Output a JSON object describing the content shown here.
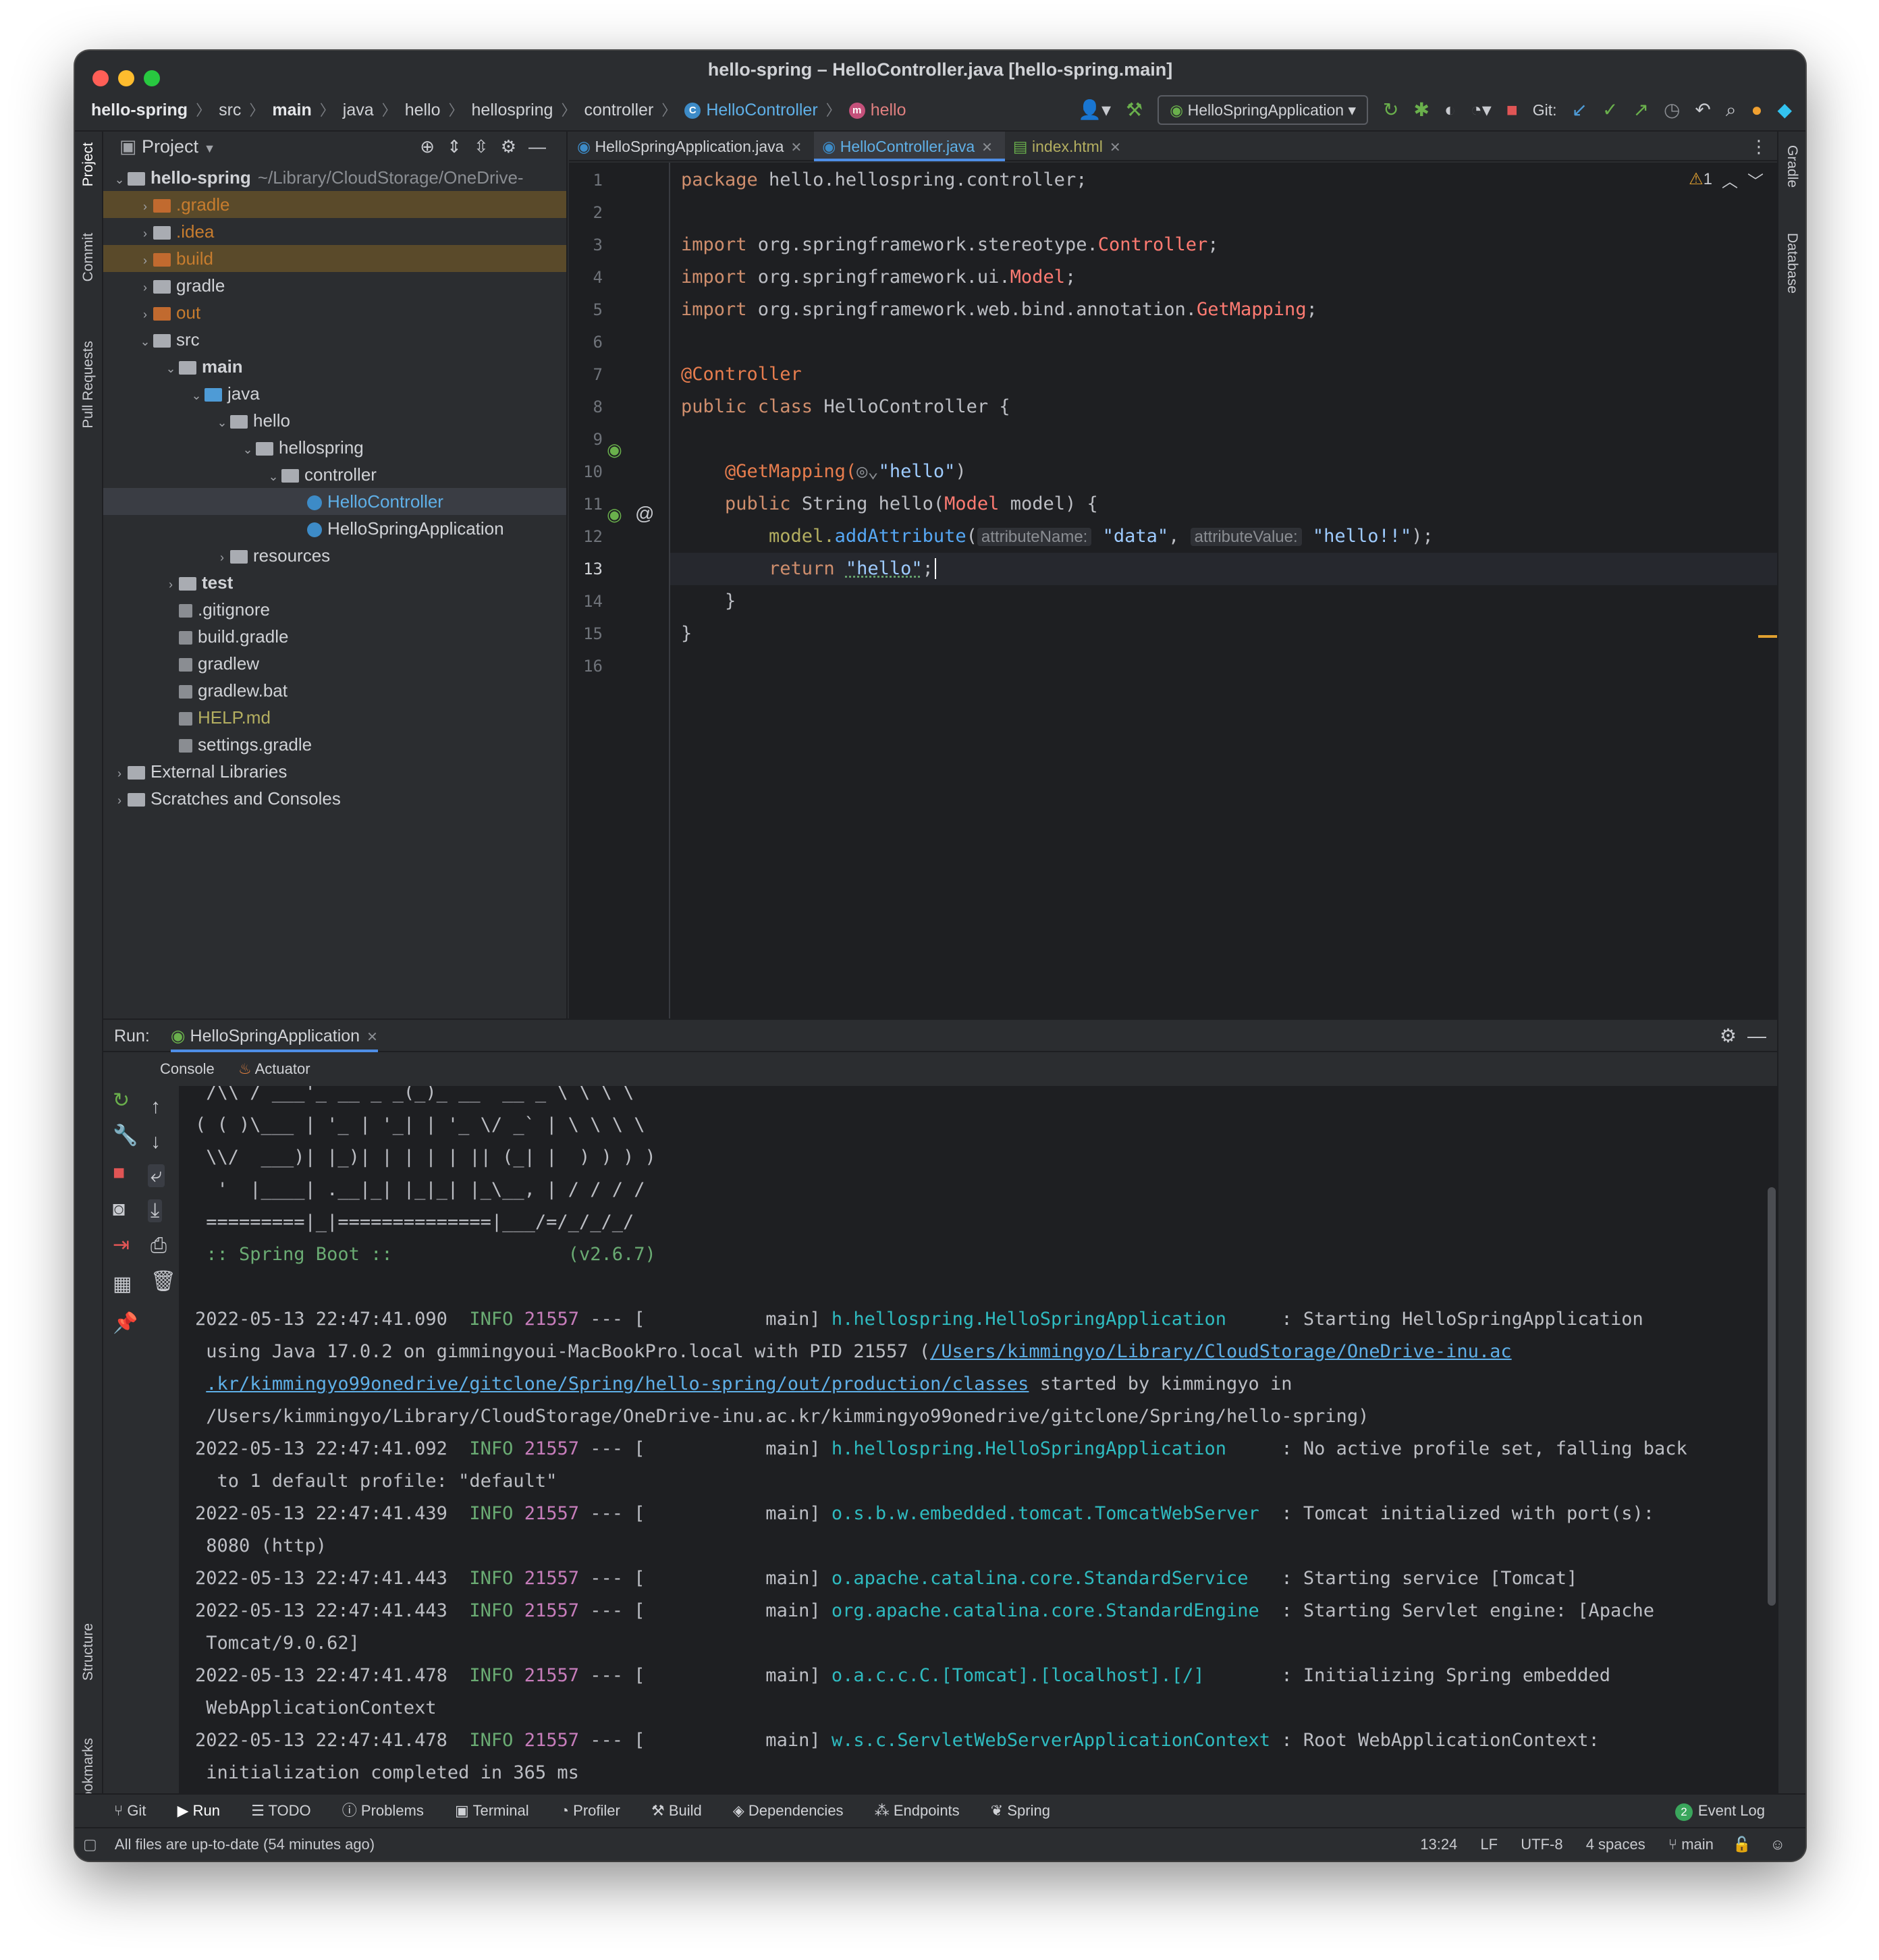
{
  "window": {
    "title": "hello-spring – HelloController.java [hello-spring.main]"
  },
  "breadcrumbs": [
    "hello-spring",
    "src",
    "main",
    "java",
    "hello",
    "hellospring",
    "controller",
    "HelloController",
    "hello"
  ],
  "toolbar": {
    "run_config": "HelloSpringApplication",
    "git_label": "Git:"
  },
  "left_strip": {
    "project": "Project",
    "commit": "Commit",
    "pull_requests": "Pull Requests",
    "structure": "Structure",
    "bookmarks": "Bookmarks"
  },
  "right_strip": {
    "gradle": "Gradle",
    "database": "Database"
  },
  "project_panel": {
    "title": "Project",
    "tree": [
      {
        "label": "hello-spring",
        "extra": "~/Library/CloudStorage/OneDrive-",
        "indent": 0,
        "bold": true
      },
      {
        "label": ".gradle",
        "indent": 1,
        "color": "#c77c2e"
      },
      {
        "label": ".idea",
        "indent": 1,
        "color": "#c77c2e"
      },
      {
        "label": "build",
        "indent": 1,
        "color": "#c77c2e"
      },
      {
        "label": "gradle",
        "indent": 1
      },
      {
        "label": "out",
        "indent": 1,
        "color": "#c77c2e"
      },
      {
        "label": "src",
        "indent": 1
      },
      {
        "label": "main",
        "indent": 2,
        "bold": true
      },
      {
        "label": "java",
        "indent": 3
      },
      {
        "label": "hello",
        "indent": 4
      },
      {
        "label": "hellospring",
        "indent": 5
      },
      {
        "label": "controller",
        "indent": 6
      },
      {
        "label": "HelloController",
        "indent": 7,
        "color": "#5fb0e8"
      },
      {
        "label": "HelloSpringApplication",
        "indent": 7
      },
      {
        "label": "resources",
        "indent": 4
      },
      {
        "label": "test",
        "indent": 2,
        "bold": true
      },
      {
        "label": ".gitignore",
        "indent": 2
      },
      {
        "label": "build.gradle",
        "indent": 2
      },
      {
        "label": "gradlew",
        "indent": 2
      },
      {
        "label": "gradlew.bat",
        "indent": 2
      },
      {
        "label": "HELP.md",
        "indent": 2,
        "color": "#b3ae60"
      },
      {
        "label": "settings.gradle",
        "indent": 2
      },
      {
        "label": "External Libraries",
        "indent": 0
      },
      {
        "label": "Scratches and Consoles",
        "indent": 0
      }
    ]
  },
  "editor_tabs": [
    "HelloSpringApplication.java",
    "HelloController.java",
    "index.html"
  ],
  "editor": {
    "warning": "1",
    "line_numbers": [
      "1",
      "2",
      "3",
      "4",
      "5",
      "6",
      "7",
      "8",
      "9",
      "10",
      "11",
      "12",
      "13",
      "14",
      "15",
      "16"
    ],
    "lines": {
      "l1a": "package ",
      "l1b": "hello.hellospring.controller;",
      "l3a": "import ",
      "l3b": "org.springframework.stereotype.",
      "l3c": "Controller",
      "l3d": ";",
      "l4a": "import ",
      "l4b": "org.springframework.ui.",
      "l4c": "Model",
      "l4d": ";",
      "l5a": "import ",
      "l5b": "org.springframework.web.bind.annotation.",
      "l5c": "GetMapping",
      "l5d": ";",
      "l7": "@Controller",
      "l8a": "public class ",
      "l8b": "HelloController {",
      "l10a": "    @GetMapping(",
      "l10b": "\"hello\"",
      "l10c": ")",
      "l11a": "    public ",
      "l11b": "String ",
      "l11c": "hello",
      "l11d": "(",
      "l11e": "Model",
      "l11f": " model) {",
      "l12a": "        model.",
      "l12b": "addAttribute",
      "l12c": "(",
      "l12h1": "attributeName:",
      "l12d": "\"data\"",
      "l12e": ", ",
      "l12h2": "attributeValue:",
      "l12f": "\"hello!!\"",
      "l12g": ");",
      "l13a": "        return ",
      "l13b": "\"hello\"",
      "l13c": ";",
      "l14": "    }",
      "l15": "}"
    }
  },
  "run": {
    "label": "Run:",
    "config": "HelloSpringApplication",
    "subtabs": [
      "Console",
      "Actuator"
    ]
  },
  "console": {
    "banner": [
      " /\\\\ / ___'_ __ _ _(_)_ __  __ _ \\ \\ \\ \\",
      "( ( )\\___ | '_ | '_| | '_ \\/ _` | \\ \\ \\ \\",
      " \\\\/  ___)| |_)| | | | | || (_| |  ) ) ) )",
      "  '  |____| .__|_| |_|_| |_\\__, | / / / /",
      " =========|_|==============|___/=/_/_/_/",
      " :: Spring Boot ::                (v2.6.7)"
    ],
    "log": [
      {
        "ts": "2022-05-13 22:47:41.090",
        "lvl": "INFO",
        "pid": "21557",
        "sep": " --- [           main] ",
        "cls": "h.hellospring.HelloSpringApplication    ",
        "msg": " : Starting HelloSpringApplication"
      },
      {
        "cont": " using Java 17.0.2 on gimmingyoui-MacBookPro.local with PID 21557 (",
        "link": "/Users/kimmingyo/Library/CloudStorage/OneDrive-inu.ac"
      },
      {
        "cont": " ",
        "link": ".kr/kimmingyo99onedrive/gitclone/Spring/hello-spring/out/production/classes",
        "after": " started by kimmingyo in"
      },
      {
        "cont": " /Users/kimmingyo/Library/CloudStorage/OneDrive-inu.ac.kr/kimmingyo99onedrive/gitclone/Spring/hello-spring)"
      },
      {
        "ts": "2022-05-13 22:47:41.092",
        "lvl": "INFO",
        "pid": "21557",
        "sep": " --- [           main] ",
        "cls": "h.hellospring.HelloSpringApplication    ",
        "msg": " : No active profile set, falling back"
      },
      {
        "cont": "  to 1 default profile: \"default\""
      },
      {
        "ts": "2022-05-13 22:47:41.439",
        "lvl": "INFO",
        "pid": "21557",
        "sep": " --- [           main] ",
        "cls": "o.s.b.w.embedded.tomcat.TomcatWebServer ",
        "msg": " : Tomcat initialized with port(s):"
      },
      {
        "cont": " 8080 (http)"
      },
      {
        "ts": "2022-05-13 22:47:41.443",
        "lvl": "INFO",
        "pid": "21557",
        "sep": " --- [           main] ",
        "cls": "o.apache.catalina.core.StandardService  ",
        "msg": " : Starting service [Tomcat]"
      },
      {
        "ts": "2022-05-13 22:47:41.443",
        "lvl": "INFO",
        "pid": "21557",
        "sep": " --- [           main] ",
        "cls": "org.apache.catalina.core.StandardEngine ",
        "msg": " : Starting Servlet engine: [Apache"
      },
      {
        "cont": " Tomcat/9.0.62]"
      },
      {
        "ts": "2022-05-13 22:47:41.478",
        "lvl": "INFO",
        "pid": "21557",
        "sep": " --- [           main] ",
        "cls": "o.a.c.c.C.[Tomcat].[localhost].[/]      ",
        "msg": " : Initializing Spring embedded"
      },
      {
        "cont": " WebApplicationContext"
      },
      {
        "ts": "2022-05-13 22:47:41.478",
        "lvl": "INFO",
        "pid": "21557",
        "sep": " --- [           main] ",
        "cls": "w.s.c.ServletWebServerApplicationContext",
        "msg": " : Root WebApplicationContext:"
      },
      {
        "cont": " initialization completed in 365 ms"
      }
    ]
  },
  "tool_windows": [
    "Git",
    "Run",
    "TODO",
    "Problems",
    "Terminal",
    "Profiler",
    "Build",
    "Dependencies",
    "Endpoints",
    "Spring"
  ],
  "event_log": {
    "count": "2",
    "label": "Event Log"
  },
  "status": {
    "message": "All files are up-to-date (54 minutes ago)",
    "position": "13:24",
    "line_sep": "LF",
    "encoding": "UTF-8",
    "indent": "4 spaces",
    "branch": "main"
  }
}
